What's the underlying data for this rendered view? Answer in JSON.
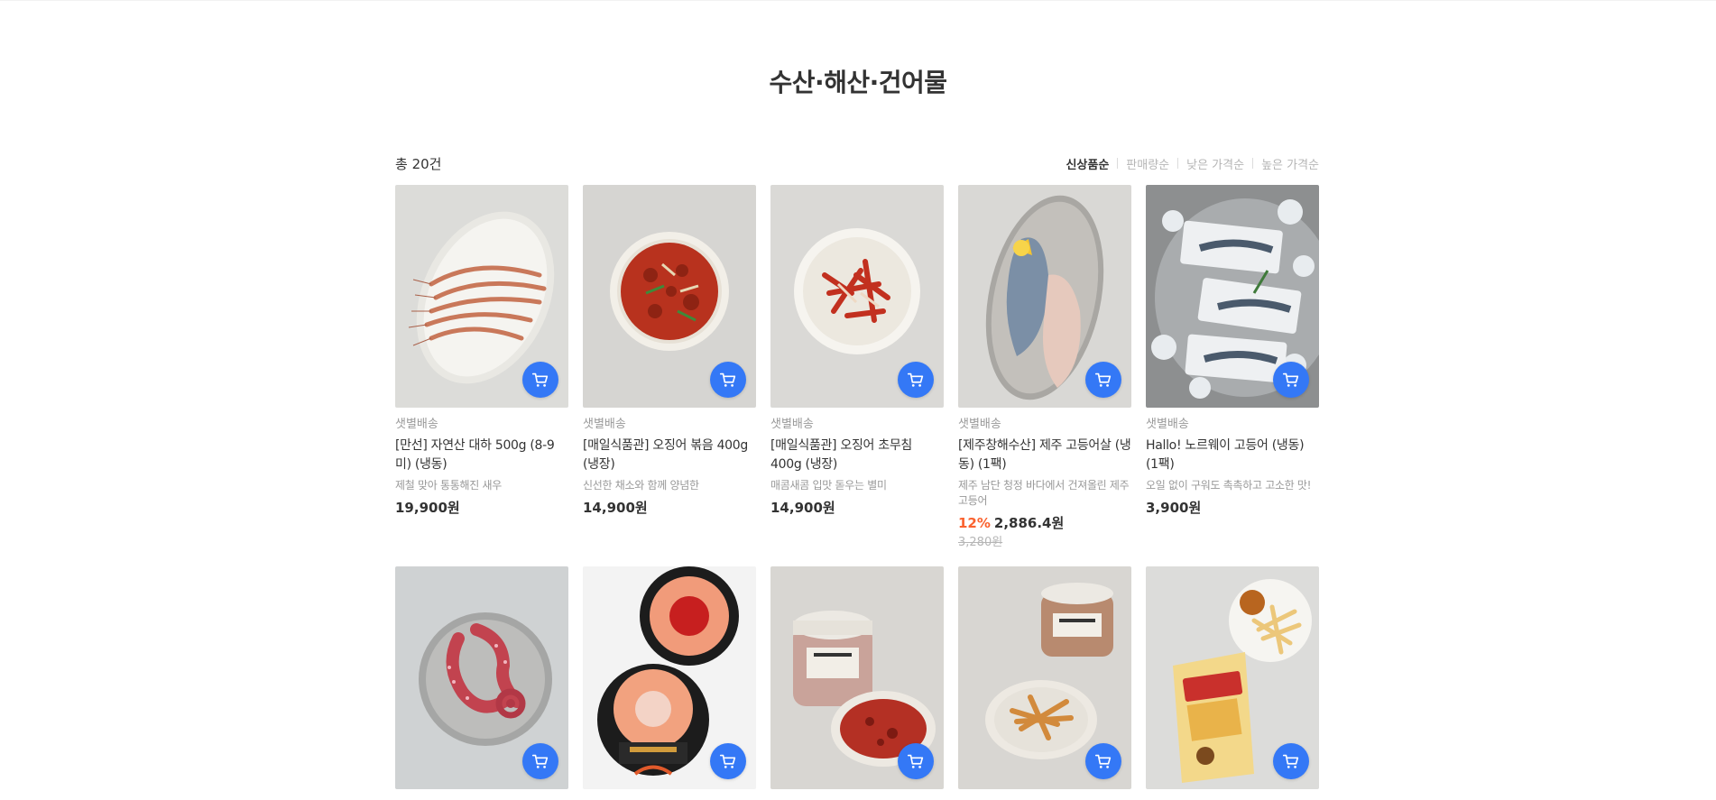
{
  "page": {
    "title": "수산·해산·건어물"
  },
  "toolbar": {
    "total": "총 20건",
    "sort": [
      "신상품순",
      "판매량순",
      "낮은 가격순",
      "높은 가격순"
    ]
  },
  "colors": {
    "accent": "#3478f6",
    "discount": "#fa622f"
  },
  "products": [
    {
      "delivery": "샛별배송",
      "name": "[만선] 자연산 대하 500g (8-9미) (냉동)",
      "desc": "제철 맞아 통통해진 새우",
      "price": "19,900원",
      "discount": "",
      "original_price": "",
      "image": "shrimp-plate"
    },
    {
      "delivery": "샛별배송",
      "name": "[매일식품관] 오징어 볶음 400g (냉장)",
      "desc": "신선한 채소와 함께 양념한",
      "price": "14,900원",
      "discount": "",
      "original_price": "",
      "image": "squid-stirfry-bowl"
    },
    {
      "delivery": "샛별배송",
      "name": "[매일식품관] 오징어 초무침 400g (냉장)",
      "desc": "매콤새콤 입맛 돋우는 별미",
      "price": "14,900원",
      "discount": "",
      "original_price": "",
      "image": "squid-salad-plate"
    },
    {
      "delivery": "샛별배송",
      "name": "[제주창해수산] 제주 고등어살 (냉동) (1팩)",
      "desc": "제주 남단 청정 바다에서 건져올린 제주 고등어",
      "price": "2,886.4원",
      "discount": "12%",
      "original_price": "3,280원",
      "image": "mackerel-fillet-plate"
    },
    {
      "delivery": "샛별배송",
      "name": "Hallo! 노르웨이 고등어 (냉동) (1팩)",
      "desc": "오일 없이 구워도 촉촉하고 고소한 맛!",
      "price": "3,900원",
      "discount": "",
      "original_price": "",
      "image": "mackerel-packs-ice"
    },
    {
      "image": "octopus-plate"
    },
    {
      "image": "shrimp-ring-trays"
    },
    {
      "image": "jar-with-seasoned-squid"
    },
    {
      "image": "jar-with-seasoned-fish"
    },
    {
      "image": "dried-pollack-pack"
    }
  ]
}
